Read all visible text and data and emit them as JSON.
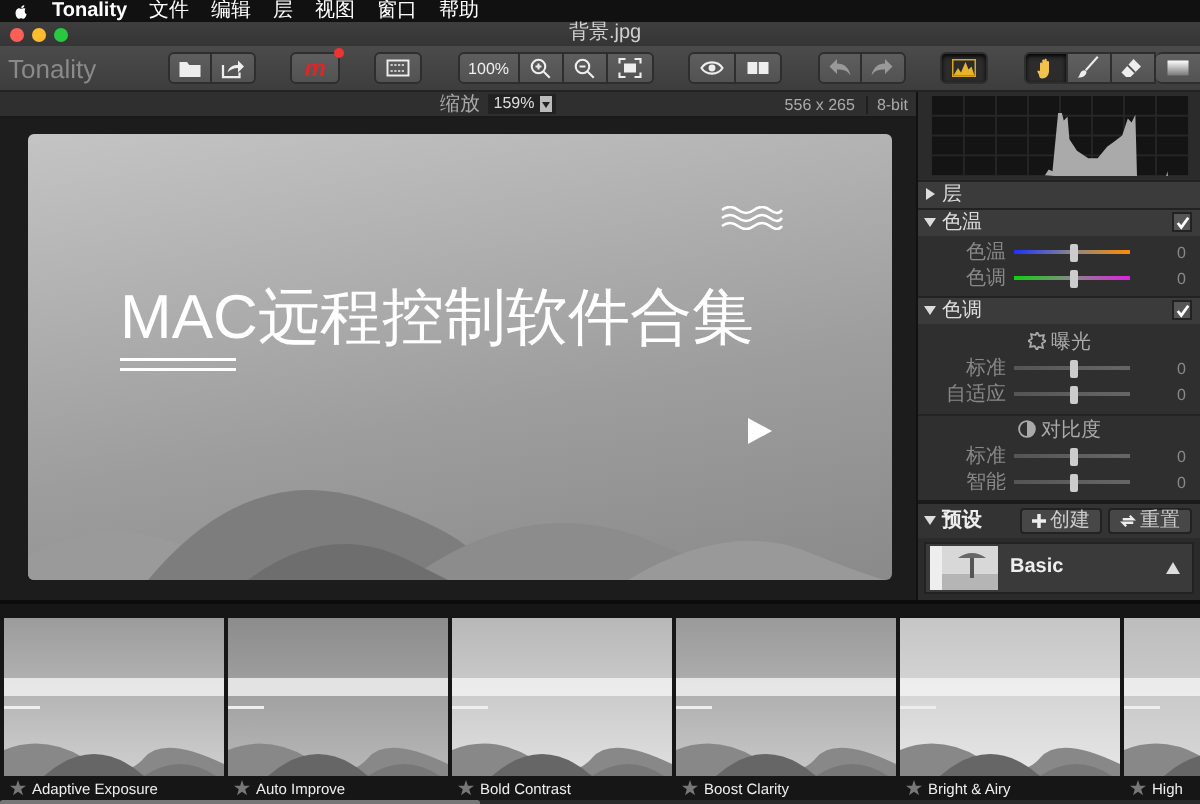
{
  "menubar": {
    "items": [
      {
        "label": "Tonality",
        "kind": "app"
      },
      {
        "label": "文件",
        "kind": "menu"
      },
      {
        "label": "编辑",
        "kind": "menu"
      },
      {
        "label": "层",
        "kind": "menu"
      },
      {
        "label": "视图",
        "kind": "menu"
      },
      {
        "label": "窗口",
        "kind": "menu"
      },
      {
        "label": "帮助",
        "kind": "menu"
      }
    ]
  },
  "window": {
    "title": "背景.jpg"
  },
  "toolbar": {
    "logo": "Tonality",
    "groups": [
      {
        "items": [
          {
            "kind": "open"
          },
          {
            "kind": "share"
          }
        ]
      },
      {
        "items": [
          {
            "kind": "masks",
            "label": "m",
            "badge": true
          }
        ]
      },
      {
        "items": [
          {
            "kind": "crop"
          }
        ]
      },
      {
        "items": [
          {
            "kind": "zoom-actual",
            "label": "100%"
          },
          {
            "kind": "zoom-in"
          },
          {
            "kind": "zoom-out"
          },
          {
            "kind": "fit"
          }
        ]
      },
      {
        "items": [
          {
            "kind": "preview"
          },
          {
            "kind": "compare"
          }
        ]
      },
      {
        "items": [
          {
            "kind": "undo"
          },
          {
            "kind": "redo"
          }
        ]
      },
      {
        "items": [
          {
            "kind": "histogram",
            "selected": true
          }
        ]
      },
      {
        "items": [
          {
            "kind": "hand",
            "selected": true
          },
          {
            "kind": "brush",
            "selected": false
          },
          {
            "kind": "eraser",
            "selected": false
          },
          {
            "kind": "gradient",
            "selected": false
          }
        ]
      }
    ]
  },
  "info_bar": {
    "zoom_label": "缩放",
    "zoom_value": "159%",
    "dimensions": "556 x 265",
    "bit_depth": "8-bit"
  },
  "canvas": {
    "image_title": "MAC远程控制软件合集"
  },
  "panel": {
    "sections": [
      {
        "title": "层",
        "expanded": false
      },
      {
        "title": "色温",
        "expanded": true,
        "checked": true,
        "groups": [
          {
            "sliders": [
              {
                "label": "色温",
                "kind": "temperature",
                "level": 0.52,
                "value": "0"
              },
              {
                "label": "色调",
                "kind": "tint",
                "level": 0.52,
                "value": "0"
              }
            ]
          }
        ]
      },
      {
        "title": "色调",
        "expanded": true,
        "checked": true,
        "groups": [
          {
            "kind": "exposure",
            "title": "曝光",
            "sliders": [
              {
                "label": "标准",
                "kind": "plain",
                "level": 0.52,
                "value": "0"
              },
              {
                "label": "自适应",
                "kind": "plain",
                "level": 0.52,
                "value": "0"
              }
            ]
          },
          {
            "kind": "contrast",
            "title": "对比度",
            "sliders": [
              {
                "label": "标准",
                "kind": "plain",
                "level": 0.52,
                "value": "0"
              },
              {
                "label": "智能",
                "kind": "plain",
                "level": 0.52,
                "value": "0"
              }
            ]
          }
        ]
      }
    ],
    "presets": {
      "title": "预设",
      "expanded": true,
      "buttons": [
        {
          "kind": "create",
          "label": "创建"
        },
        {
          "kind": "reset",
          "label": "重置"
        }
      ],
      "item": {
        "name": "Basic"
      }
    }
  },
  "filmstrip": {
    "presets": [
      {
        "name": "Adaptive Exposure"
      },
      {
        "name": "Auto Improve"
      },
      {
        "name": "Bold Contrast"
      },
      {
        "name": "Boost Clarity"
      },
      {
        "name": "Bright & Airy"
      },
      {
        "name": "High"
      }
    ]
  }
}
